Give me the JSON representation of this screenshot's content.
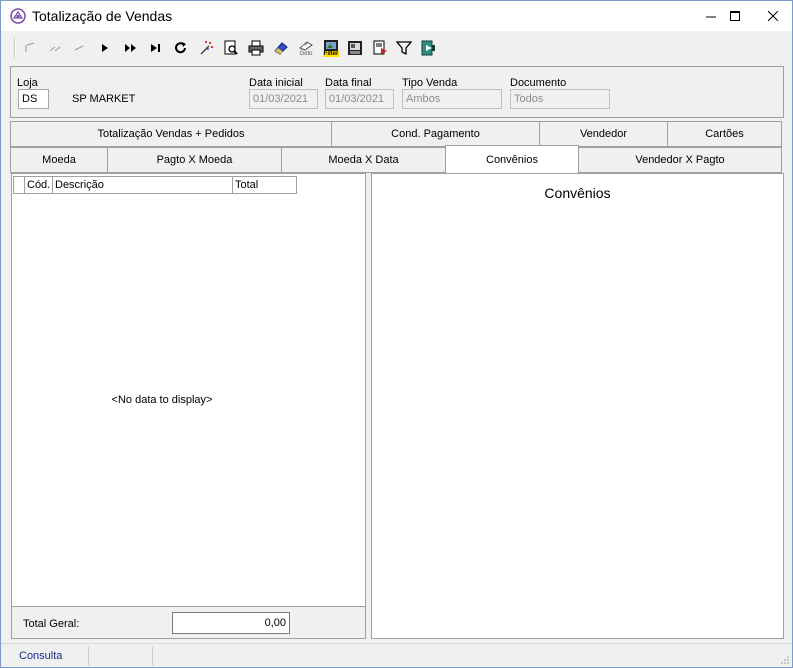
{
  "window": {
    "title": "Totalização de Vendas"
  },
  "toolbar": {
    "icons": [
      "first-record-icon",
      "prior-page-icon",
      "prior-record-icon",
      "next-record-icon",
      "next-page-icon",
      "last-record-icon",
      "refresh-icon",
      "magic-wand-icon",
      "print-preview-icon",
      "printer-icon",
      "eraser-icon",
      "goto-icon",
      "filter-image-icon",
      "export-icon",
      "save-report-icon",
      "funnel-filter-icon",
      "exit-door-icon"
    ],
    "goto_label": "Goto",
    "filter_label": "Filter"
  },
  "filters": {
    "loja_label": "Loja",
    "loja_value": "DS",
    "loja_name": "SP MARKET",
    "data_inicial_label": "Data inicial",
    "data_inicial_value": "01/03/2021",
    "data_final_label": "Data final",
    "data_final_value": "01/03/2021",
    "tipo_venda_label": "Tipo Venda",
    "tipo_venda_value": "Ambos",
    "documento_label": "Documento",
    "documento_value": "Todos"
  },
  "tabs": {
    "row1": [
      "Totalização Vendas + Pedidos",
      "Cond. Pagamento",
      "Vendedor",
      "Cartões"
    ],
    "row2": [
      "Moeda",
      "Pagto X Moeda",
      "Moeda X Data",
      "Convênios",
      "Vendedor X Pagto"
    ],
    "active": "Convênios"
  },
  "grid": {
    "columns": [
      "Cód.",
      "Descrição",
      "Total"
    ],
    "empty_text": "<No data to display>",
    "total_label": "Total Geral:",
    "total_value": "0,00"
  },
  "chart": {
    "title": "Convênios"
  },
  "status": {
    "mode": "Consulta"
  },
  "colors": {
    "border": "#a0a0a0",
    "status_text": "#1c2b8a",
    "accent": "#7a4fa6"
  }
}
